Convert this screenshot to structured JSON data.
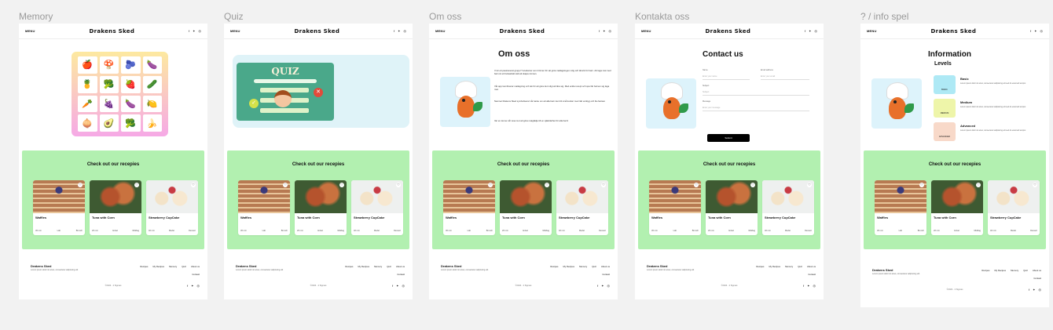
{
  "frames": [
    {
      "label": "Memory"
    },
    {
      "label": "Quiz"
    },
    {
      "label": "Om oss"
    },
    {
      "label": "Kontakta oss"
    },
    {
      "label": "? / info spel"
    }
  ],
  "nav": {
    "menu": "MENU",
    "brand": "Drakens Sked",
    "social": [
      "f",
      "✦",
      "◎"
    ]
  },
  "recipes": {
    "title": "Check out our recepies",
    "cards": [
      {
        "name": "Waffles",
        "meta": [
          "30 min",
          "Lätt",
          "Brunch"
        ]
      },
      {
        "name": "Tuna with Corn",
        "meta": [
          "20 min",
          "Enkel",
          "Middag"
        ]
      },
      {
        "name": "Strawberry CupCake",
        "meta": [
          "40 min",
          "Medel",
          "Dessert"
        ]
      }
    ]
  },
  "footer": {
    "brand": "Drakens Sked",
    "tagline": "Lorem ipsum dolor sit amet, consectetur adipiscing elit",
    "links": [
      "Recipes",
      "My Recipes",
      "Memory",
      "Quiz",
      "About us"
    ],
    "contact": "Contact",
    "copyright": "©2024 · 2 Sigmas"
  },
  "quiz": {
    "title": "QUIZ"
  },
  "about": {
    "title": "Om oss",
    "p1": "Vi är ett passionerat grupp IT-studenter som brinner för att göra matlagningen rolig och lärorik för barn. Att laga mat med barn är ett fantastiskt sätt att skapa minnen.",
    "p2": "Vår app kombinerar matlagning och lek för att göra det roligt att lära sig. Med enkla recept och spel lär barnen sig laga mat.",
    "p3": "Namnet Drakens Sked symboliserar vår tanke om att alla barn kan bli små kockar med rätt verktyg och lite fantasi.",
    "p4": "Var en del av vår resa mot att göra matglädje till en självklarhet för alla barn!"
  },
  "contact": {
    "title": "Contact us",
    "name": "Name",
    "email": "Email address",
    "subject": "Subject",
    "message": "Message",
    "name_ph": "Enter your name",
    "email_ph": "Enter your email",
    "subject_ph": "Subject",
    "message_ph": "Enter your message",
    "submit": "Submit"
  },
  "info": {
    "title": "Information",
    "levels_title": "Levels",
    "levels": [
      {
        "badge": "BASIC",
        "name": "Basic",
        "color": "#aee9f5",
        "desc": "Lorem ipsum dolor sit amet, consectetur adipiscing elit sed do eiusmod tempor."
      },
      {
        "badge": "MEDIUM",
        "name": "Medium",
        "color": "#eef5a9",
        "desc": "Lorem ipsum dolor sit amet, consectetur adipiscing elit sed do eiusmod tempor."
      },
      {
        "badge": "ADVANCED",
        "name": "Advanced",
        "color": "#f8d9c9",
        "desc": "Lorem ipsum dolor sit amet, consectetur adipiscing elit sed do eiusmod tempor."
      }
    ]
  },
  "memory": {
    "cells": [
      "🍎",
      "🍄",
      "🫐",
      "🍆",
      "🍍",
      "🥦",
      "🍓",
      "🥒",
      "🥕",
      "🍇",
      "🍆",
      "🍋",
      "🧅",
      "🥑",
      "🥦",
      "🍌"
    ]
  }
}
